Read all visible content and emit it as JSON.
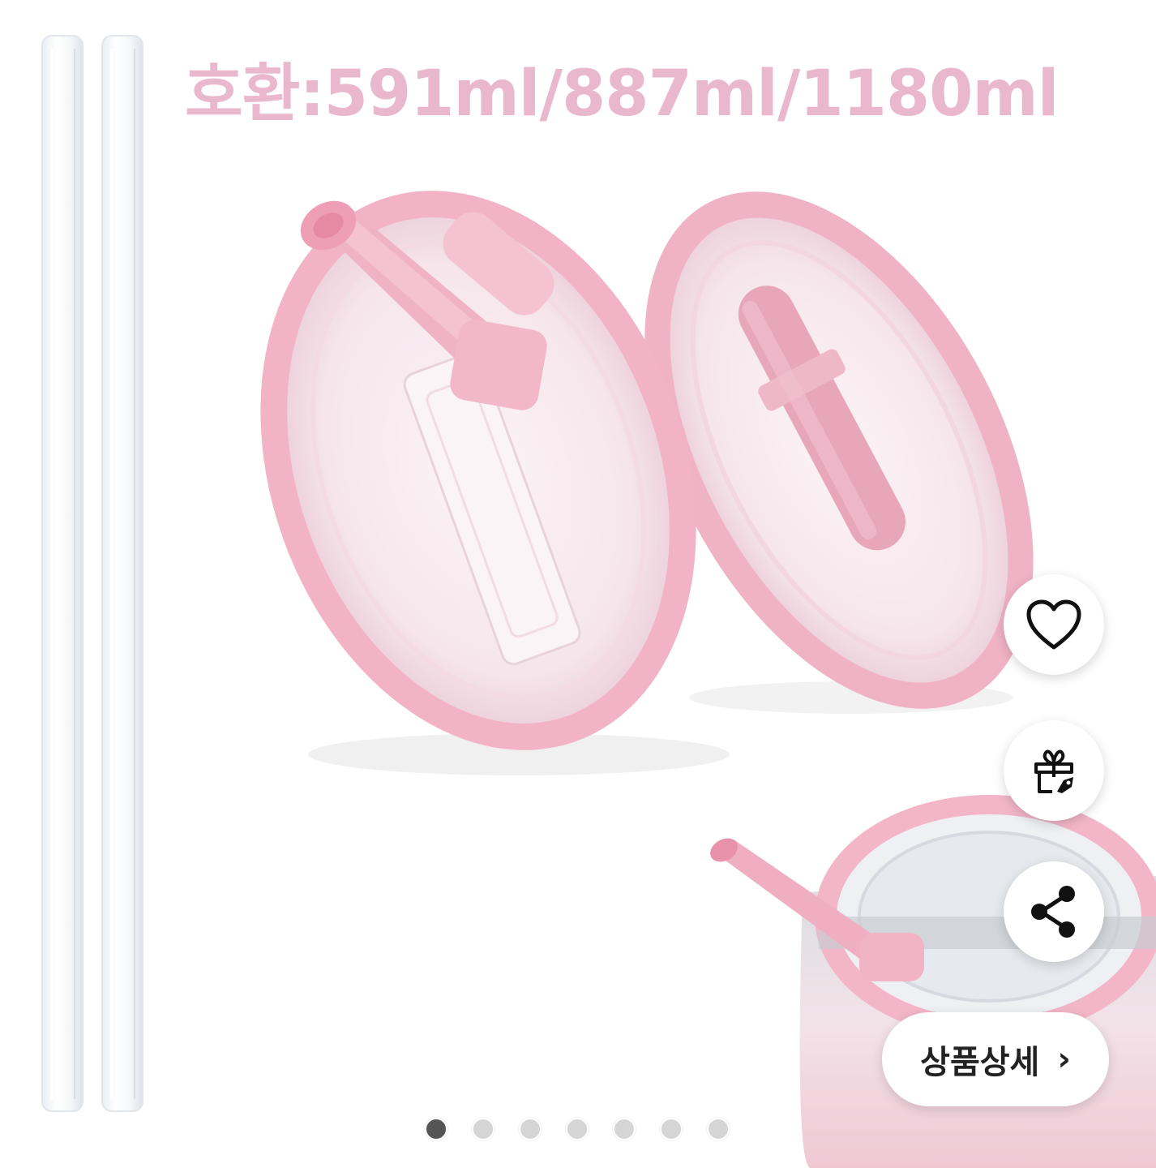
{
  "product": {
    "headline": "호환:591ml/887ml/1180ml"
  },
  "actions": {
    "like": "heart-icon",
    "gift": "gift-icon",
    "share": "share-icon"
  },
  "detail_button": {
    "label": "상품상세",
    "chevron": "›"
  },
  "gallery": {
    "total": 7,
    "current": 1
  },
  "colors": {
    "accent_pink": "#eab8cc",
    "lid_pink": "#f2b3c6",
    "active_dot": "#555555",
    "inactive_dot": "#d5d5d5"
  }
}
